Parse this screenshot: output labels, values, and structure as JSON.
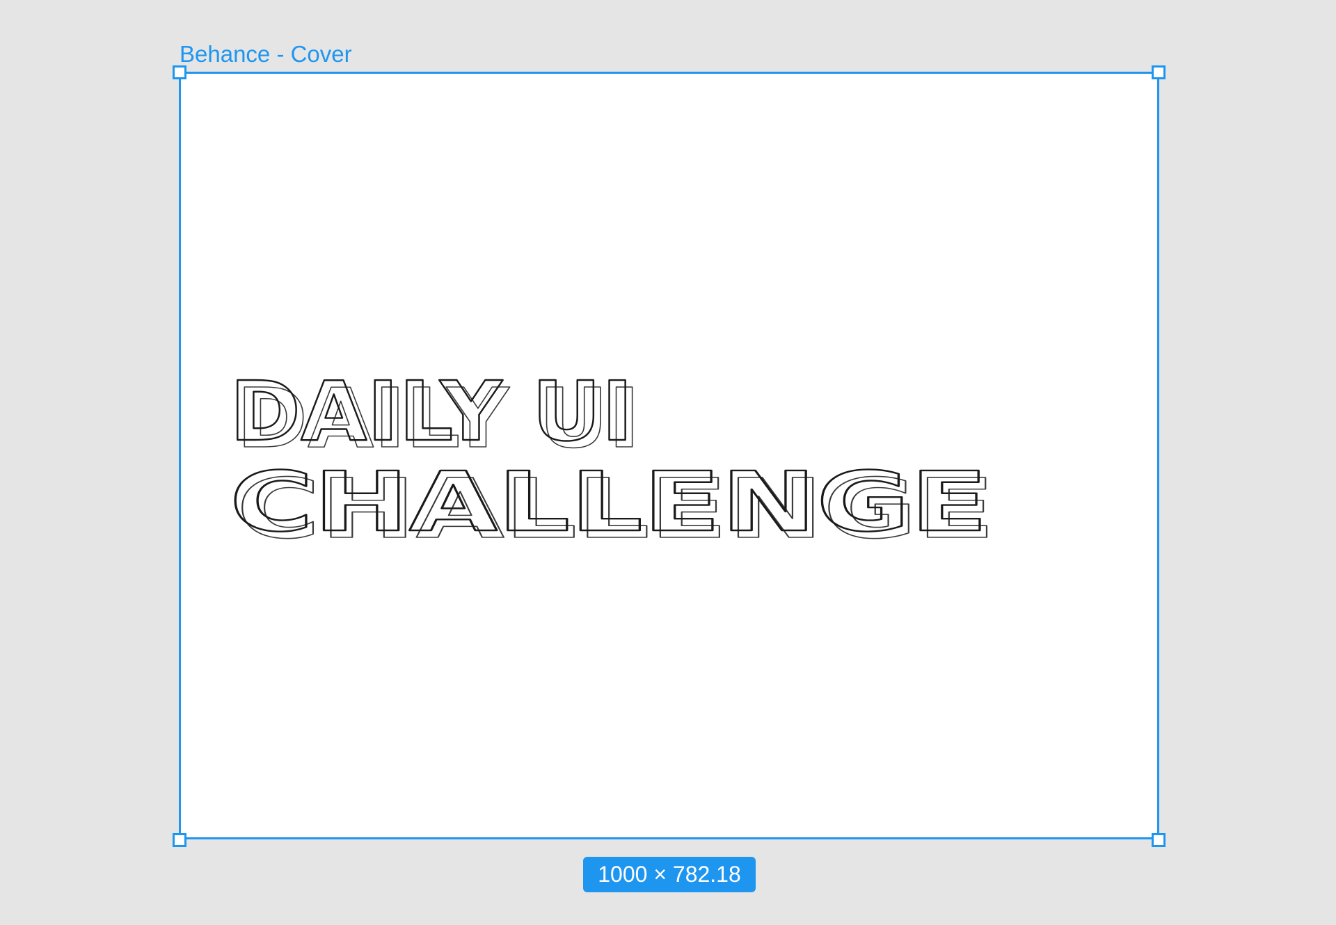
{
  "artboard": {
    "label": "Behance - Cover",
    "size_badge": "1000 × 782.18",
    "accent_color": "#1e96f0"
  },
  "artwork": {
    "line1": "DAILY UI",
    "line2": "CHALLENGE"
  }
}
